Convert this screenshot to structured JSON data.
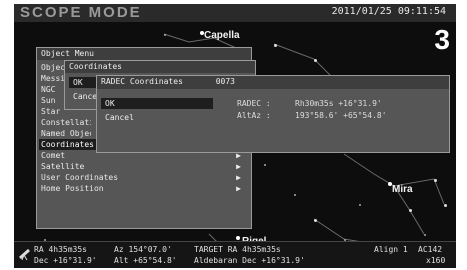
{
  "header": {
    "mode_title": "SCOPE MODE",
    "datetime": "2011/01/25  09:11:54",
    "badge": "3"
  },
  "sky_labels": {
    "capella": "Capella",
    "mira": "Mira",
    "rigel": "Rigel"
  },
  "object_menu": {
    "title": "Object Menu",
    "items": [
      {
        "label": "Object",
        "arrow": ""
      },
      {
        "label": "Messier",
        "arrow": ""
      },
      {
        "label": "NGC",
        "arrow": ""
      },
      {
        "label": "Sun",
        "arrow": ""
      },
      {
        "label": "Star",
        "arrow": ""
      },
      {
        "label": "Constellation",
        "arrow": ""
      },
      {
        "label": "Named Objects",
        "arrow": ""
      },
      {
        "label": "Coordinates",
        "arrow": "▶"
      },
      {
        "label": "Comet",
        "arrow": "▶"
      },
      {
        "label": "Satellite",
        "arrow": "▶"
      },
      {
        "label": "User Coordinates",
        "arrow": "▶"
      },
      {
        "label": "Home Position",
        "arrow": "▶"
      }
    ]
  },
  "coordinates_menu": {
    "title": "Coordinates",
    "ok": "OK",
    "cancel": "Cancel"
  },
  "radec_window": {
    "title": "RADEC Coordinates",
    "id": "0073",
    "ok": "OK",
    "cancel": "Cancel",
    "radec_label": "RADEC :",
    "radec_value": "Rh30m35s  +16°31.9'",
    "altaz_label": "AltAz :",
    "altaz_value": "193°58.6'  +65°54.8'"
  },
  "status_bar": {
    "ra": "RA   4h35m35s",
    "az": "Az  154°07.0'",
    "target": "TARGET  RA  4h35m35s",
    "align": "Align 1",
    "ac": "AC142",
    "dec": "Dec +16°31.9'",
    "alt": "Alt +65°54.8'",
    "target_name": "Aldebaran Dec +16°31.9'",
    "code": "x160"
  },
  "colors": {
    "screen_bg": "#0d0d0d",
    "menu_bg": "#565656",
    "selected_bg": "#1c1c1c"
  },
  "icons": {
    "status_left": "telescope-icon",
    "submenu": "right-triangle-arrow"
  }
}
